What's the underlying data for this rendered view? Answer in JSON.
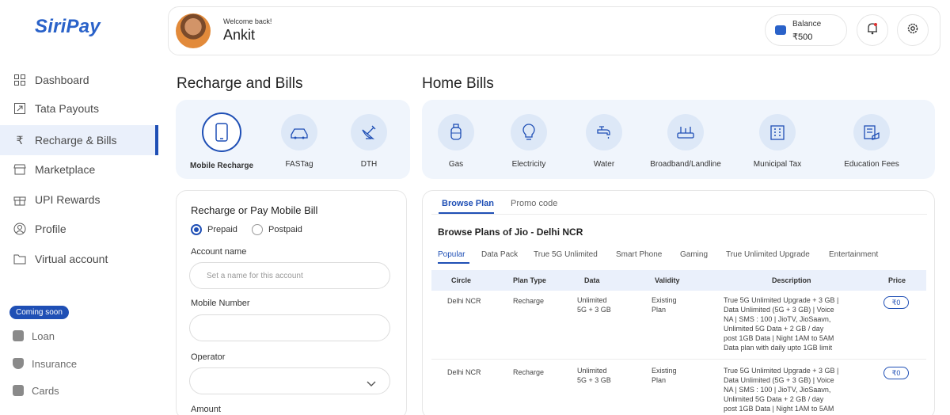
{
  "app": {
    "logo": "SiriPay"
  },
  "sidebar": {
    "items": [
      {
        "label": "Dashboard",
        "icon": "grid-icon"
      },
      {
        "label": "Tata Payouts",
        "icon": "arrow-up-right-icon"
      },
      {
        "label": "Recharge & Bills",
        "icon": "rupee-icon",
        "active": true
      },
      {
        "label": "Marketplace",
        "icon": "store-icon"
      },
      {
        "label": "UPI Rewards",
        "icon": "gift-icon"
      },
      {
        "label": "Profile",
        "icon": "user-icon"
      },
      {
        "label": "Virtual account",
        "icon": "folder-icon"
      }
    ],
    "coming_soon_badge": "Coming soon",
    "soon_items": [
      {
        "label": "Loan"
      },
      {
        "label": "Insurance"
      },
      {
        "label": "Cards"
      }
    ]
  },
  "header": {
    "welcome": "Welcome back!",
    "username": "Ankit",
    "balance_label": "Balance",
    "balance_value": "₹500"
  },
  "recharge": {
    "title": "Recharge and Bills",
    "services": [
      {
        "label": "Mobile Recharge",
        "icon": "phone-icon",
        "selected": true
      },
      {
        "label": "FASTag",
        "icon": "fastag-icon"
      },
      {
        "label": "DTH",
        "icon": "satellite-dish-icon"
      }
    ]
  },
  "home_bills": {
    "title": "Home Bills",
    "services": [
      {
        "label": "Gas",
        "icon": "gas-cylinder-icon"
      },
      {
        "label": "Electricity",
        "icon": "bulb-icon"
      },
      {
        "label": "Water",
        "icon": "tap-icon"
      },
      {
        "label": "Broadband/Landline",
        "icon": "router-icon"
      },
      {
        "label": "Municipal Tax",
        "icon": "building-icon"
      },
      {
        "label": "Education Fees",
        "icon": "education-icon"
      }
    ]
  },
  "form": {
    "title": "Recharge or Pay Mobile Bill",
    "radio_prepaid": "Prepaid",
    "radio_postpaid": "Postpaid",
    "account_label": "Account name",
    "account_placeholder": "Set a name for this account",
    "mobile_label": "Mobile Number",
    "operator_label": "Operator",
    "amount_label": "Amount"
  },
  "plans": {
    "tabs": [
      "Browse Plan",
      "Promo code"
    ],
    "heading": "Browse Plans of Jio - Delhi NCR",
    "categories": [
      "Popular",
      "Data Pack",
      "True 5G Unlimited",
      "Smart Phone",
      "Gaming",
      "True Unlimited Upgrade",
      "Entertainment"
    ],
    "columns": [
      "Circle",
      "Plan Type",
      "Data",
      "Validity",
      "Description",
      "Price"
    ],
    "rows": [
      {
        "circle": "Delhi NCR",
        "plan_type": "Recharge",
        "data": [
          "Unlimited",
          "5G + 3 GB"
        ],
        "validity": [
          "Existing",
          "Plan"
        ],
        "description": [
          "True 5G Unlimited Upgrade + 3 GB |",
          "Data Unlimited (5G + 3 GB) | Voice",
          "NA | SMS : 100 | JioTV, JioSaavn,",
          "Unlimited 5G Data + 2 GB / day",
          "post 1GB Data | Night 1AM to 5AM",
          "Data plan with daily upto 1GB limit"
        ],
        "price": "₹0"
      },
      {
        "circle": "Delhi NCR",
        "plan_type": "Recharge",
        "data": [
          "Unlimited",
          "5G + 3 GB"
        ],
        "validity": [
          "Existing",
          "Plan"
        ],
        "description": [
          "True 5G Unlimited Upgrade + 3 GB |",
          "Data Unlimited (5G + 3 GB) | Voice",
          "NA | SMS : 100 | JioTV, JioSaavn,",
          "Unlimited 5G Data + 2 GB / day",
          "post 1GB Data | Night 1AM to 5AM"
        ],
        "price": "₹0"
      }
    ]
  }
}
